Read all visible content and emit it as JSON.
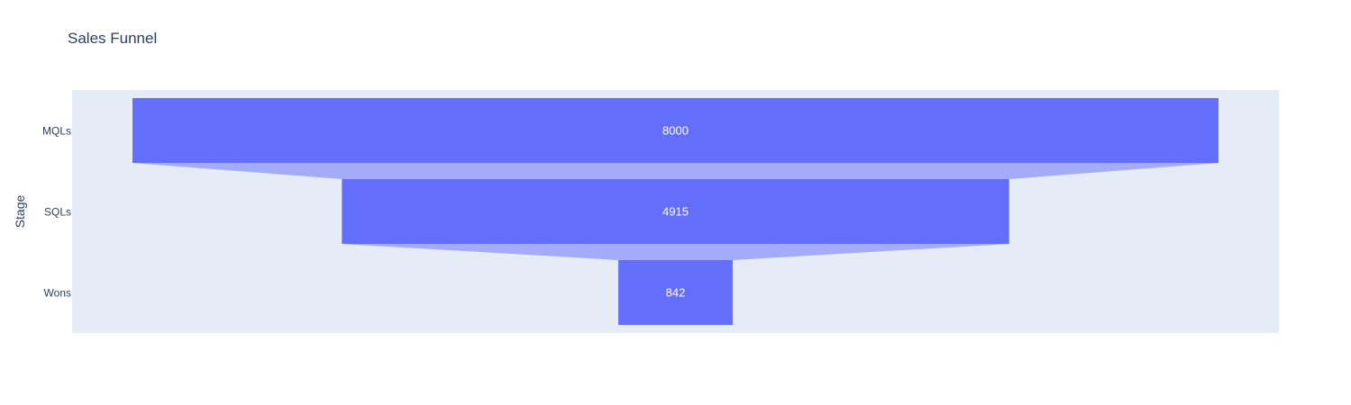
{
  "chart_data": {
    "type": "funnel",
    "title": "Sales Funnel",
    "ylabel": "Stage",
    "categories": [
      "MQLs",
      "SQLs",
      "Wons"
    ],
    "values": [
      8000,
      4915,
      842
    ],
    "colors": {
      "bar": "#636efa",
      "connector": "#a4abf8",
      "plot_bg": "#e5ecf6",
      "text": "#2a3f5f",
      "value_text": "#ffffff"
    }
  }
}
